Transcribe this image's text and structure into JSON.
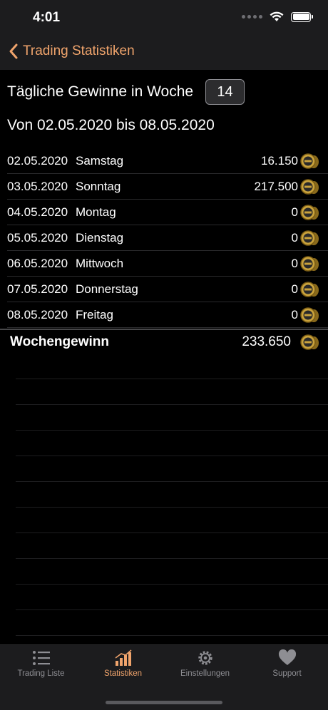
{
  "status_bar": {
    "time": "4:01"
  },
  "nav": {
    "back_label": "Trading Statistiken"
  },
  "week": {
    "title": "Tägliche Gewinne in Woche",
    "number": "14",
    "range": "Von 02.05.2020 bis 08.05.2020"
  },
  "days": [
    {
      "date": "02.05.2020",
      "name": "Samstag",
      "value": "16.150"
    },
    {
      "date": "03.05.2020",
      "name": "Sonntag",
      "value": "217.500"
    },
    {
      "date": "04.05.2020",
      "name": "Montag",
      "value": "0"
    },
    {
      "date": "05.05.2020",
      "name": "Dienstag",
      "value": "0"
    },
    {
      "date": "06.05.2020",
      "name": "Mittwoch",
      "value": "0"
    },
    {
      "date": "07.05.2020",
      "name": "Donnerstag",
      "value": "0"
    },
    {
      "date": "08.05.2020",
      "name": "Freitag",
      "value": "0"
    }
  ],
  "total": {
    "label": "Wochengewinn",
    "value": "233.650"
  },
  "tabs": [
    {
      "label": "Trading Liste",
      "icon": "list-icon"
    },
    {
      "label": "Statistiken",
      "icon": "chart-icon"
    },
    {
      "label": "Einstellungen",
      "icon": "gear-icon"
    },
    {
      "label": "Support",
      "icon": "heart-icon"
    }
  ],
  "colors": {
    "accent": "#f0a46c",
    "background": "#000000",
    "bar": "#1c1c1e",
    "inactive": "#8e8e93"
  }
}
